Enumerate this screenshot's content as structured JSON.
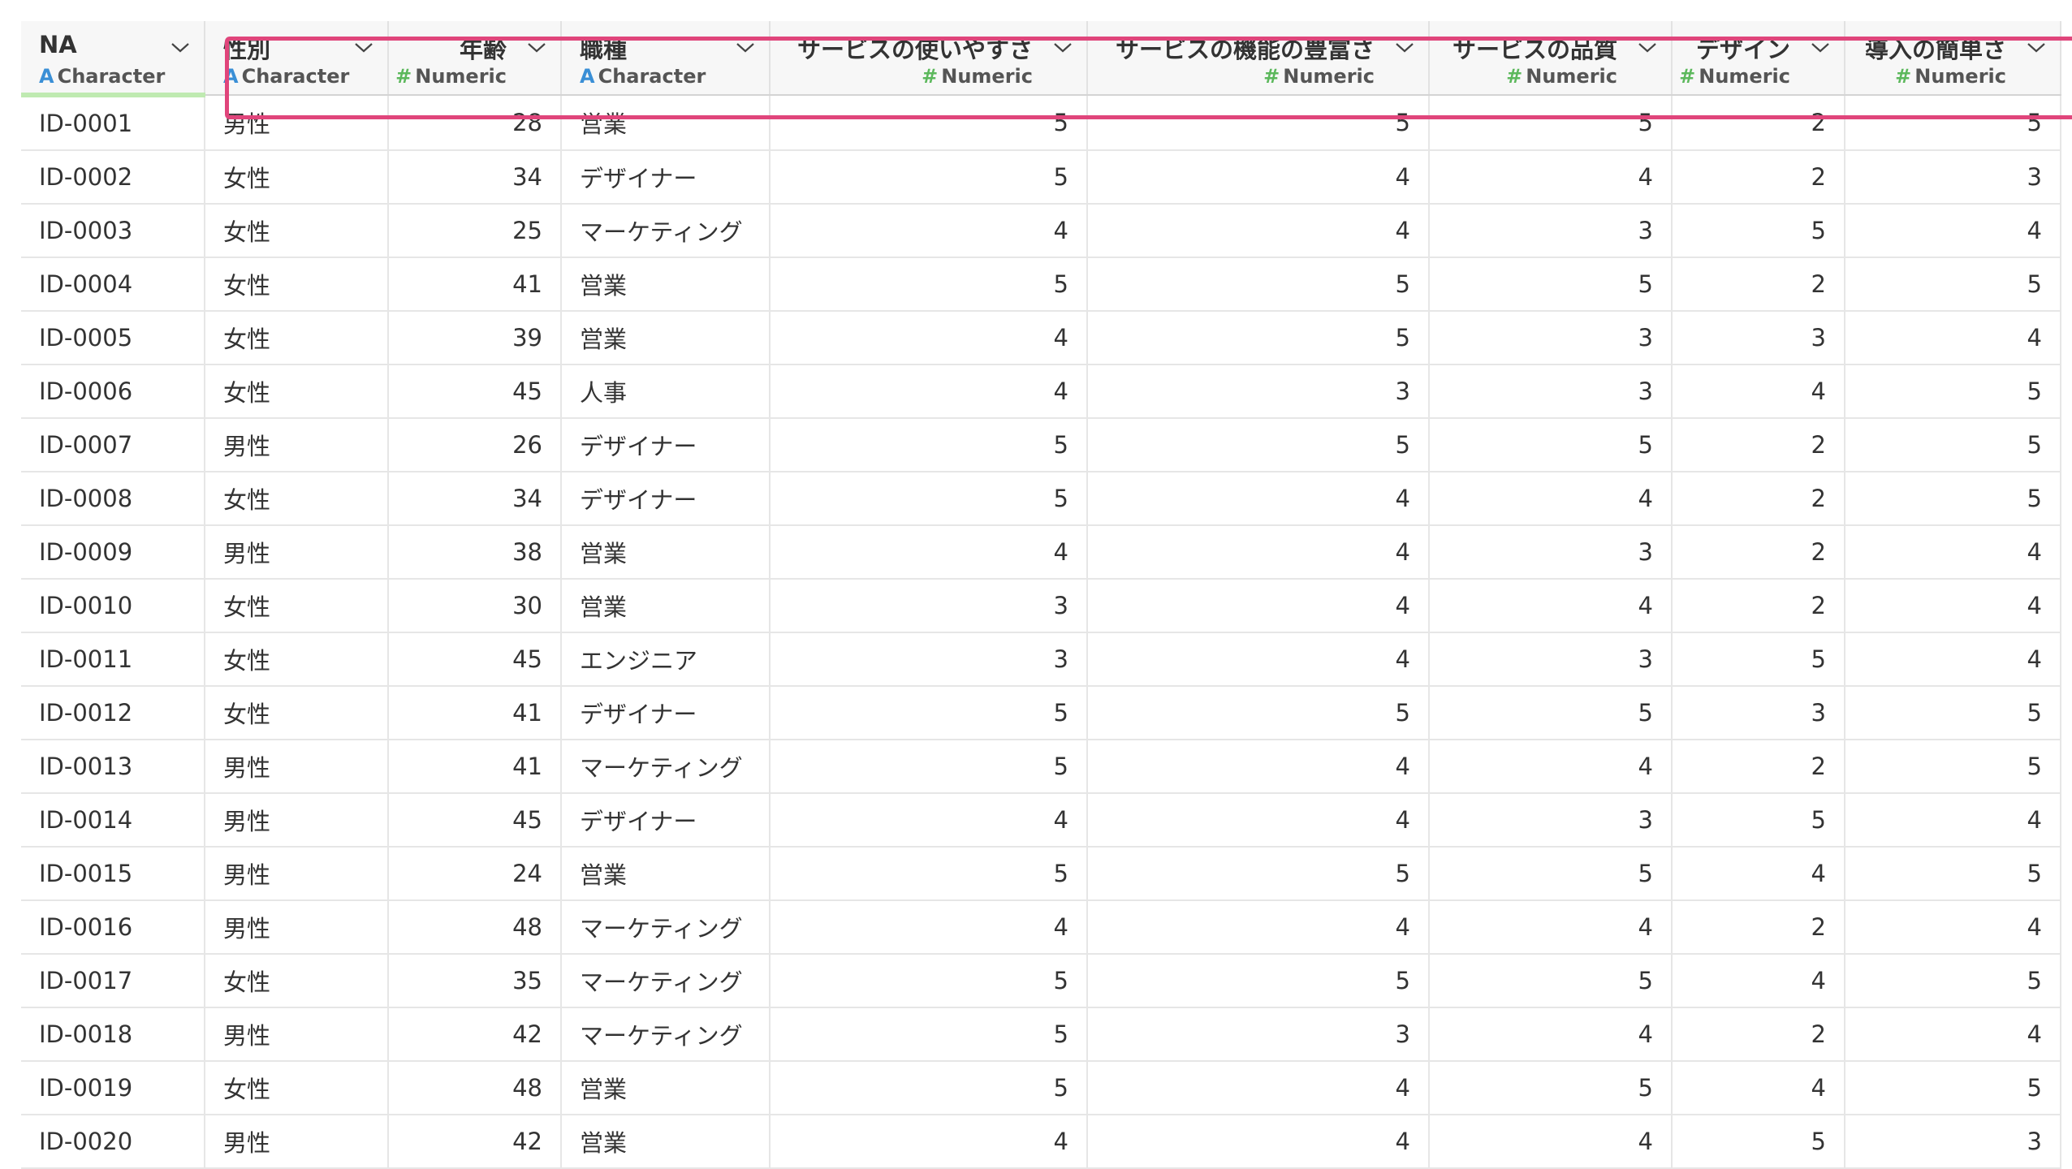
{
  "columns": [
    {
      "name": "NA",
      "type": "Character",
      "kind": "char",
      "align": "left"
    },
    {
      "name": "性別",
      "type": "Character",
      "kind": "char",
      "align": "left"
    },
    {
      "name": "年齢",
      "type": "Numeric",
      "kind": "num",
      "align": "right"
    },
    {
      "name": "職種",
      "type": "Character",
      "kind": "char",
      "align": "left"
    },
    {
      "name": "サービスの使いやすさ",
      "type": "Numeric",
      "kind": "num",
      "align": "right"
    },
    {
      "name": "サービスの機能の豊富さ",
      "type": "Numeric",
      "kind": "num",
      "align": "right"
    },
    {
      "name": "サービスの品質",
      "type": "Numeric",
      "kind": "num",
      "align": "right"
    },
    {
      "name": "デザイン",
      "type": "Numeric",
      "kind": "num",
      "align": "right"
    },
    {
      "name": "導入の簡単さ",
      "type": "Numeric",
      "kind": "num",
      "align": "right"
    }
  ],
  "type_glyphs": {
    "char": "A",
    "num": "#"
  },
  "colors": {
    "highlight_border": "#e0457b",
    "character_glyph": "#3a8fd6",
    "numeric_glyph": "#5cb85c",
    "first_column_underline": "#bfeab1"
  },
  "rows": [
    [
      "ID-0001",
      "男性",
      "28",
      "営業",
      "5",
      "5",
      "5",
      "2",
      "5"
    ],
    [
      "ID-0002",
      "女性",
      "34",
      "デザイナー",
      "5",
      "4",
      "4",
      "2",
      "3"
    ],
    [
      "ID-0003",
      "女性",
      "25",
      "マーケティング",
      "4",
      "4",
      "3",
      "5",
      "4"
    ],
    [
      "ID-0004",
      "女性",
      "41",
      "営業",
      "5",
      "5",
      "5",
      "2",
      "5"
    ],
    [
      "ID-0005",
      "女性",
      "39",
      "営業",
      "4",
      "5",
      "3",
      "3",
      "4"
    ],
    [
      "ID-0006",
      "女性",
      "45",
      "人事",
      "4",
      "3",
      "3",
      "4",
      "5"
    ],
    [
      "ID-0007",
      "男性",
      "26",
      "デザイナー",
      "5",
      "5",
      "5",
      "2",
      "5"
    ],
    [
      "ID-0008",
      "女性",
      "34",
      "デザイナー",
      "5",
      "4",
      "4",
      "2",
      "5"
    ],
    [
      "ID-0009",
      "男性",
      "38",
      "営業",
      "4",
      "4",
      "3",
      "2",
      "4"
    ],
    [
      "ID-0010",
      "女性",
      "30",
      "営業",
      "3",
      "4",
      "4",
      "2",
      "4"
    ],
    [
      "ID-0011",
      "女性",
      "45",
      "エンジニア",
      "3",
      "4",
      "3",
      "5",
      "4"
    ],
    [
      "ID-0012",
      "女性",
      "41",
      "デザイナー",
      "5",
      "5",
      "5",
      "3",
      "5"
    ],
    [
      "ID-0013",
      "男性",
      "41",
      "マーケティング",
      "5",
      "4",
      "4",
      "2",
      "5"
    ],
    [
      "ID-0014",
      "男性",
      "45",
      "デザイナー",
      "4",
      "4",
      "3",
      "5",
      "4"
    ],
    [
      "ID-0015",
      "男性",
      "24",
      "営業",
      "5",
      "5",
      "5",
      "4",
      "5"
    ],
    [
      "ID-0016",
      "男性",
      "48",
      "マーケティング",
      "4",
      "4",
      "4",
      "2",
      "4"
    ],
    [
      "ID-0017",
      "女性",
      "35",
      "マーケティング",
      "5",
      "5",
      "5",
      "4",
      "5"
    ],
    [
      "ID-0018",
      "男性",
      "42",
      "マーケティング",
      "5",
      "3",
      "4",
      "2",
      "4"
    ],
    [
      "ID-0019",
      "女性",
      "48",
      "営業",
      "5",
      "4",
      "5",
      "4",
      "5"
    ],
    [
      "ID-0020",
      "男性",
      "42",
      "営業",
      "4",
      "4",
      "4",
      "5",
      "3"
    ]
  ]
}
